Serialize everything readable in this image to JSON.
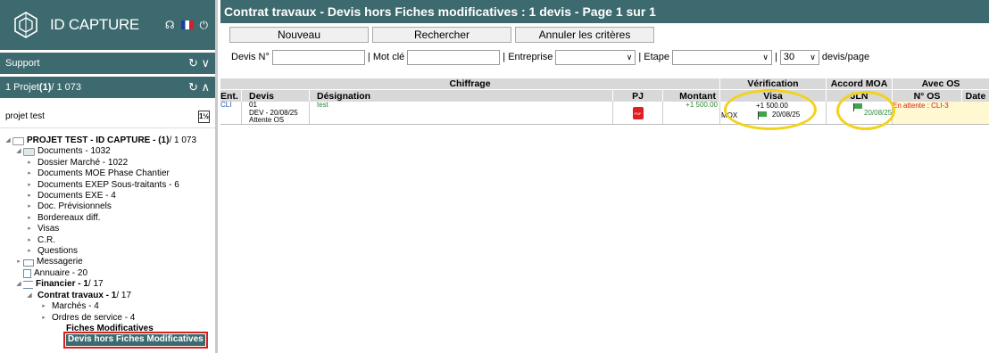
{
  "sidebar": {
    "app_name": "ID CAPTURE",
    "support_label": "Support",
    "project_count_prefix": "1 Projet ",
    "project_count_bold": "(1)",
    "project_count_suffix": " / 1 073",
    "search_value": "projet test",
    "tree": {
      "project_label": "PROJET TEST - ID CAPTURE - (1)",
      "project_suffix": " / 1 073",
      "documents": "Documents - 1032",
      "documents_children": [
        "Dossier Marché - 1022",
        "Documents MOE Phase Chantier",
        "Documents EXEP Sous-traitants - 6",
        "Documents EXE - 4",
        "Doc. Prévisionnels",
        "Bordereaux diff.",
        "Visas",
        "C.R.",
        "Questions"
      ],
      "messagerie": "Messagerie",
      "annuaire": "Annuaire - 20",
      "financier": "Financier - 1",
      "financier_suffix": " / 17",
      "contrat": "Contrat travaux - 1",
      "contrat_suffix": " / 17",
      "marches": "Marchés - 4",
      "ordres": "Ordres de service - 4",
      "fiches": "Fiches Modificatives",
      "devis_hors": "Devis hors Fiches Modificatives"
    }
  },
  "main": {
    "title": "Contrat travaux - Devis hors Fiches modificatives  :  1 devis   - Page 1 sur 1",
    "buttons": {
      "new": "Nouveau",
      "search": "Rechercher",
      "cancel": "Annuler les critères"
    },
    "filters": {
      "devis_label": "Devis N°",
      "mot_cle_label": "| Mot clé",
      "entreprise_label": "| Entreprise",
      "etape_label": "| Etape",
      "per_page_value": "30",
      "per_page_label": "devis/page",
      "sep": "|"
    },
    "table": {
      "groups": {
        "chiffrage": "Chiffrage",
        "verification": "Vérification",
        "accord": "Accord MOA",
        "avec_os": "Avec OS"
      },
      "columns": {
        "ent": "Ent.",
        "devis": "Devis",
        "designation": "Désignation",
        "pj": "PJ",
        "montant": "Montant",
        "visa": "Visa",
        "jln": "JLN",
        "num_os": "N° OS",
        "date": "Date"
      },
      "row": {
        "ent": "CLI",
        "devis_num": "01",
        "devis_ref": "DEV - 20/08/25",
        "devis_status": "Attente OS",
        "designation": "test",
        "pj_label": "PDF",
        "montant": "+1 500.00",
        "visa_who": "MOX",
        "visa_amount": "+1 500.00",
        "visa_date": "20/08/25",
        "jln_date": "20/08/25",
        "os_status": "En attente : CLI-3"
      }
    }
  },
  "colors": {
    "header": "#3d6a6e",
    "highlight": "#f2d21b",
    "green_flag": "#3fa34d"
  }
}
